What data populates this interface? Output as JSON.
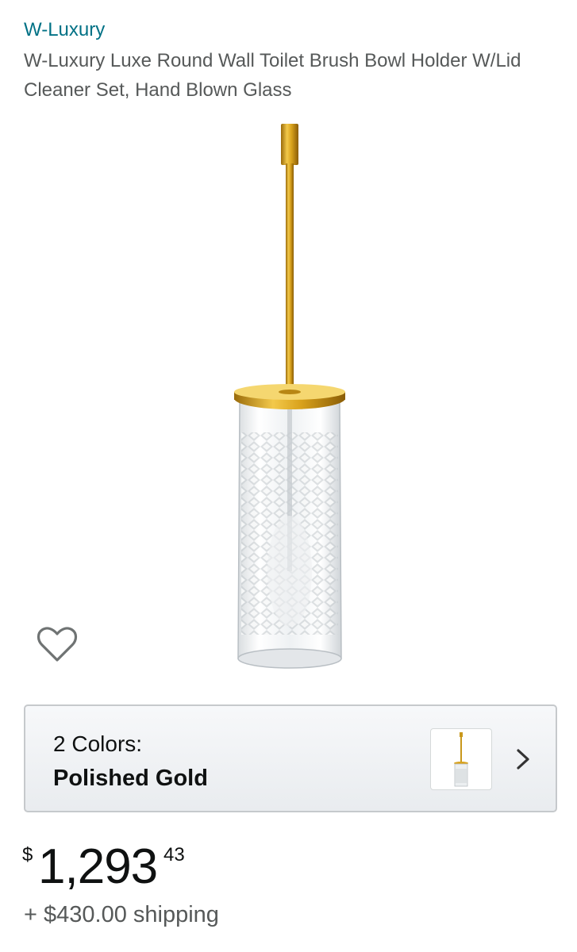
{
  "product": {
    "brand": "W-Luxury",
    "title": "W-Luxury Luxe Round Wall Toilet Brush Bowl Holder W/Lid Cleaner Set, Hand Blown Glass"
  },
  "image": {
    "subject": "toilet-brush-holder-icon",
    "wishlist_icon": "heart-outline-icon"
  },
  "variation": {
    "count_label": "2 Colors:",
    "selected": "Polished Gold",
    "chevron_icon": "chevron-right-icon"
  },
  "price": {
    "symbol": "$",
    "whole": "1,293",
    "fraction": "43"
  },
  "shipping": {
    "text": "+ $430.00 shipping"
  },
  "colors": {
    "link": "#007185",
    "title": "#565959",
    "gold": "#d4a017",
    "border": "#c6c9cc"
  }
}
